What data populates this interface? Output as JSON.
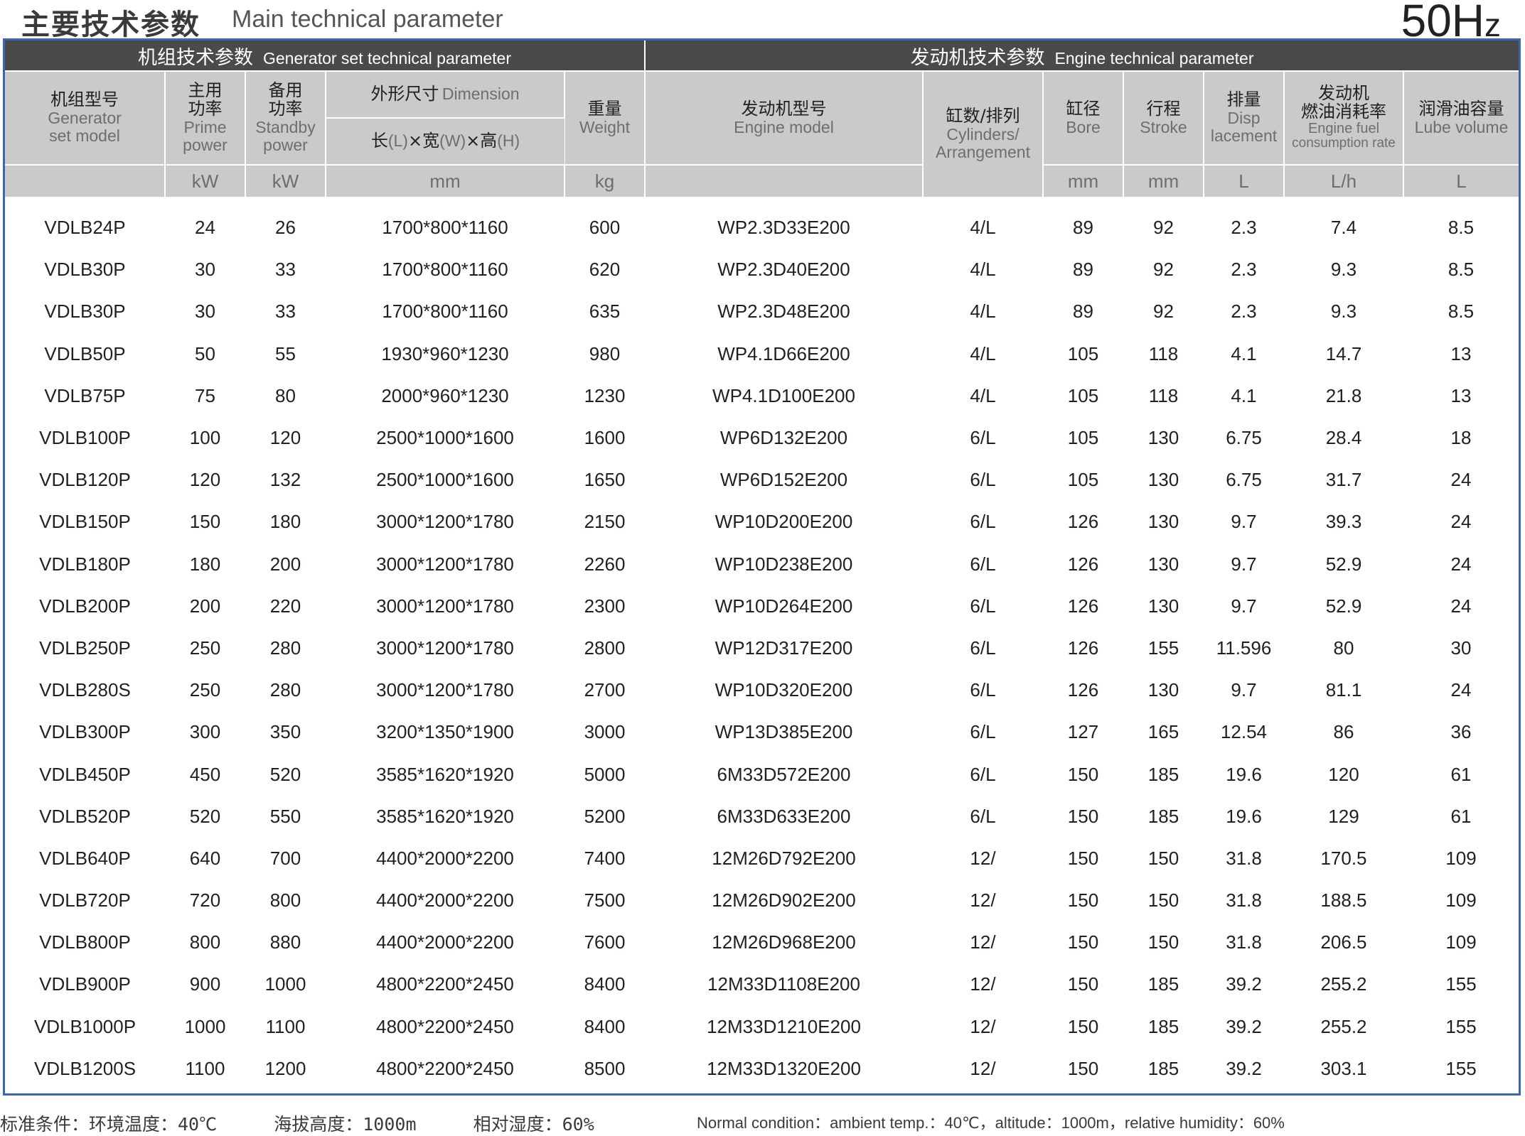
{
  "header": {
    "title_cn": "主要技术参数",
    "title_en": "Main technical parameter",
    "freq_main": "50H",
    "freq_sub": "z"
  },
  "groups": {
    "generator_cn": "机组技术参数",
    "generator_en": "Generator set technical parameter",
    "engine_cn": "发动机技术参数",
    "engine_en": "Engine technical parameter"
  },
  "columns": {
    "model_cn": "机组型号",
    "model_en_1": "Generator",
    "model_en_2": "set model",
    "prime_cn_1": "主用",
    "prime_cn_2": "功率",
    "prime_en_1": "Prime",
    "prime_en_2": "power",
    "standby_cn_1": "备用",
    "standby_cn_2": "功率",
    "standby_en_1": "Standby",
    "standby_en_2": "power",
    "dimension_cn": "外形尺寸",
    "dimension_en": "Dimension",
    "dim_l_cn": "长",
    "dim_l": "(L)",
    "dim_x1": "×",
    "dim_w_cn": "宽",
    "dim_w": "(W)",
    "dim_x2": "×",
    "dim_h_cn": "高",
    "dim_h": "(H)",
    "weight_cn": "重量",
    "weight_en": "Weight",
    "engine_model_cn": "发动机型号",
    "engine_model_en": "Engine model",
    "cyl_cn": "缸数/排列",
    "cyl_en_1": "Cylinders/",
    "cyl_en_2": "Arrangement",
    "bore_cn": "缸径",
    "bore_en": "Bore",
    "stroke_cn": "行程",
    "stroke_en": "Stroke",
    "disp_cn": "排量",
    "disp_en_1": "Disp",
    "disp_en_2": "lacement",
    "fuel_cn_1": "发动机",
    "fuel_cn_2": "燃油消耗率",
    "fuel_en_1": "Engine fuel",
    "fuel_en_2": "consumption rate",
    "lube_cn": "润滑油容量",
    "lube_en": "Lube volume"
  },
  "units": {
    "prime": "kW",
    "standby": "kW",
    "dimension": "mm",
    "weight": "kg",
    "bore": "mm",
    "stroke": "mm",
    "disp": "L",
    "fuel": "L/h",
    "lube": "L"
  },
  "rows": [
    [
      "VDLB24P",
      "24",
      "26",
      "1700*800*1160",
      "600",
      "WP2.3D33E200",
      "4/L",
      "89",
      "92",
      "2.3",
      "7.4",
      "8.5"
    ],
    [
      "VDLB30P",
      "30",
      "33",
      "1700*800*1160",
      "620",
      "WP2.3D40E200",
      "4/L",
      "89",
      "92",
      "2.3",
      "9.3",
      "8.5"
    ],
    [
      "VDLB30P",
      "30",
      "33",
      "1700*800*1160",
      "635",
      "WP2.3D48E200",
      "4/L",
      "89",
      "92",
      "2.3",
      "9.3",
      "8.5"
    ],
    [
      "VDLB50P",
      "50",
      "55",
      "1930*960*1230",
      "980",
      "WP4.1D66E200",
      "4/L",
      "105",
      "118",
      "4.1",
      "14.7",
      "13"
    ],
    [
      "VDLB75P",
      "75",
      "80",
      "2000*960*1230",
      "1230",
      "WP4.1D100E200",
      "4/L",
      "105",
      "118",
      "4.1",
      "21.8",
      "13"
    ],
    [
      "VDLB100P",
      "100",
      "120",
      "2500*1000*1600",
      "1600",
      "WP6D132E200",
      "6/L",
      "105",
      "130",
      "6.75",
      "28.4",
      "18"
    ],
    [
      "VDLB120P",
      "120",
      "132",
      "2500*1000*1600",
      "1650",
      "WP6D152E200",
      "6/L",
      "105",
      "130",
      "6.75",
      "31.7",
      "24"
    ],
    [
      "VDLB150P",
      "150",
      "180",
      "3000*1200*1780",
      "2150",
      "WP10D200E200",
      "6/L",
      "126",
      "130",
      "9.7",
      "39.3",
      "24"
    ],
    [
      "VDLB180P",
      "180",
      "200",
      "3000*1200*1780",
      "2260",
      "WP10D238E200",
      "6/L",
      "126",
      "130",
      "9.7",
      "52.9",
      "24"
    ],
    [
      "VDLB200P",
      "200",
      "220",
      "3000*1200*1780",
      "2300",
      "WP10D264E200",
      "6/L",
      "126",
      "130",
      "9.7",
      "52.9",
      "24"
    ],
    [
      "VDLB250P",
      "250",
      "280",
      "3000*1200*1780",
      "2800",
      "WP12D317E200",
      "6/L",
      "126",
      "155",
      "11.596",
      "80",
      "30"
    ],
    [
      "VDLB280S",
      "250",
      "280",
      "3000*1200*1780",
      "2700",
      "WP10D320E200",
      "6/L",
      "126",
      "130",
      "9.7",
      "81.1",
      "24"
    ],
    [
      "VDLB300P",
      "300",
      "350",
      "3200*1350*1900",
      "3000",
      "WP13D385E200",
      "6/L",
      "127",
      "165",
      "12.54",
      "86",
      "36"
    ],
    [
      "VDLB450P",
      "450",
      "520",
      "3585*1620*1920",
      "5000",
      "6M33D572E200",
      "6/L",
      "150",
      "185",
      "19.6",
      "120",
      "61"
    ],
    [
      "VDLB520P",
      "520",
      "550",
      "3585*1620*1920",
      "5200",
      "6M33D633E200",
      "6/L",
      "150",
      "185",
      "19.6",
      "129",
      "61"
    ],
    [
      "VDLB640P",
      "640",
      "700",
      "4400*2000*2200",
      "7400",
      "12M26D792E200",
      "12/",
      "150",
      "150",
      "31.8",
      "170.5",
      "109"
    ],
    [
      "VDLB720P",
      "720",
      "800",
      "4400*2000*2200",
      "7500",
      "12M26D902E200",
      "12/",
      "150",
      "150",
      "31.8",
      "188.5",
      "109"
    ],
    [
      "VDLB800P",
      "800",
      "880",
      "4400*2000*2200",
      "7600",
      "12M26D968E200",
      "12/",
      "150",
      "150",
      "31.8",
      "206.5",
      "109"
    ],
    [
      "VDLB900P",
      "900",
      "1000",
      "4800*2200*2450",
      "8400",
      "12M33D1108E200",
      "12/",
      "150",
      "185",
      "39.2",
      "255.2",
      "155"
    ],
    [
      "VDLB1000P",
      "1000",
      "1100",
      "4800*2200*2450",
      "8400",
      "12M33D1210E200",
      "12/",
      "150",
      "185",
      "39.2",
      "255.2",
      "155"
    ],
    [
      "VDLB1200S",
      "1100",
      "1200",
      "4800*2200*2450",
      "8500",
      "12M33D1320E200",
      "12/",
      "150",
      "185",
      "39.2",
      "303.1",
      "155"
    ]
  ],
  "footnote": {
    "cn_1": "标准条件：环境温度：40℃",
    "cn_2": "海拔高度：1000m",
    "cn_3": "相对湿度：60%",
    "en": "Normal condition：ambient temp.：40℃，altitude：1000m，relative humidity：60%"
  }
}
